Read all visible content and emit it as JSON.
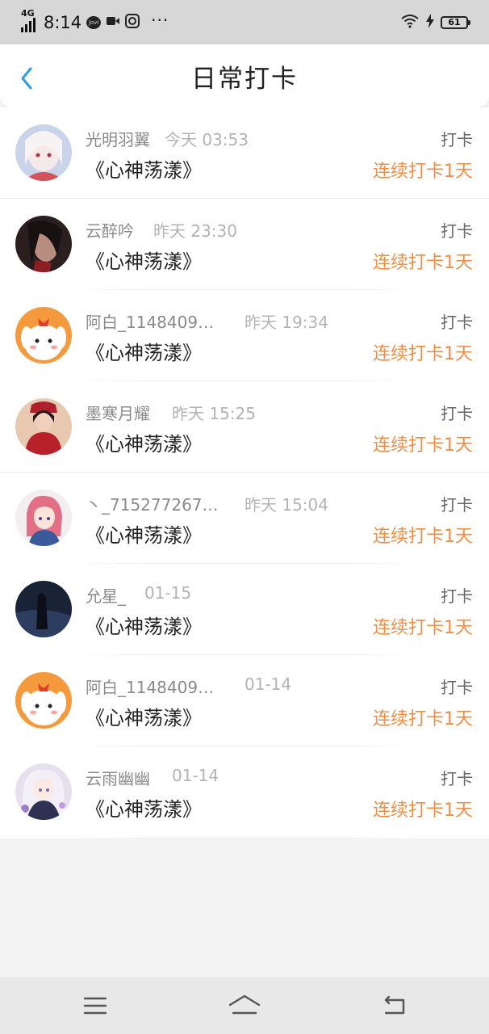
{
  "status_bar": {
    "network": "4G",
    "time": "8:14",
    "app_badge": "Jovi",
    "more": "···",
    "battery": "61",
    "icons": [
      "signal-icon",
      "jovi-icon",
      "video-icon",
      "camera-icon",
      "wifi-icon",
      "charging-icon",
      "battery-icon"
    ]
  },
  "nav": {
    "title": "日常打卡",
    "back_icon": "chevron-left-icon",
    "accent": "#2b9fe6"
  },
  "entries": [
    {
      "name": "光明羽翼",
      "time": "今天 03:53",
      "book": "《心神荡漾》",
      "action": "打卡",
      "streak": "连续打卡1天"
    },
    {
      "name": "云醉吟",
      "time": "昨天 23:30",
      "book": "《心神荡漾》",
      "action": "打卡",
      "streak": "连续打卡1天"
    },
    {
      "name": "阿白_1148409…",
      "time": "昨天 19:34",
      "book": "《心神荡漾》",
      "action": "打卡",
      "streak": "连续打卡1天"
    },
    {
      "name": "墨寒月耀",
      "time": "昨天 15:25",
      "book": "《心神荡漾》",
      "action": "打卡",
      "streak": "连续打卡1天"
    },
    {
      "name": "丶_715277267…",
      "time": "昨天 15:04",
      "book": "《心神荡漾》",
      "action": "打卡",
      "streak": "连续打卡1天"
    },
    {
      "name": "允星_",
      "time": "01-15",
      "book": "《心神荡漾》",
      "action": "打卡",
      "streak": "连续打卡1天"
    },
    {
      "name": "阿白_1148409…",
      "time": "01-14",
      "book": "《心神荡漾》",
      "action": "打卡",
      "streak": "连续打卡1天"
    },
    {
      "name": "云雨幽幽",
      "time": "01-14",
      "book": "《心神荡漾》",
      "action": "打卡",
      "streak": "连续打卡1天"
    }
  ],
  "colors": {
    "streak": "#f08d44",
    "background": "#f4f3f4"
  },
  "bottom_nav": [
    "menu-icon",
    "home-icon",
    "back-icon"
  ]
}
